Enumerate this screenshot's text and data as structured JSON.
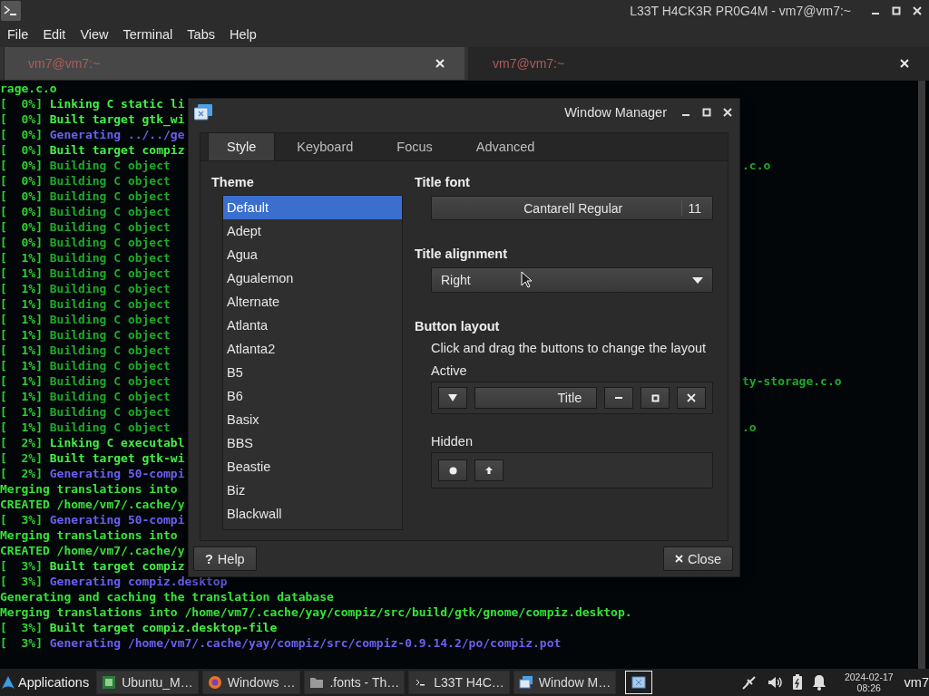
{
  "terminal": {
    "title": "L33T H4CK3R PR0G4M - vm7@vm7:~",
    "menu": [
      "File",
      "Edit",
      "View",
      "Terminal",
      "Tabs",
      "Help"
    ],
    "tabs": [
      {
        "label": "vm7@vm7:~",
        "selected": true
      },
      {
        "label": "vm7@vm7:~",
        "selected": false
      }
    ],
    "lines": [
      {
        "kind": "plain",
        "text": "rage.c.o"
      },
      {
        "kind": "bold",
        "progress": "[  0%]",
        "text": "Linking C static li"
      },
      {
        "kind": "bold",
        "progress": "[  0%]",
        "text": "Built target gtk_wi"
      },
      {
        "kind": "blue",
        "progress": "[  0%]",
        "text": "Generating ../../ge"
      },
      {
        "kind": "bold",
        "progress": "[  0%]",
        "text": "Built target compiz"
      },
      {
        "kind": "dim",
        "progress": "[  0%]",
        "text": "Building C object",
        "tail": ".c.o"
      },
      {
        "kind": "dim",
        "progress": "[  0%]",
        "text": "Building C object"
      },
      {
        "kind": "dim",
        "progress": "[  0%]",
        "text": "Building C object"
      },
      {
        "kind": "dim",
        "progress": "[  0%]",
        "text": "Building C object"
      },
      {
        "kind": "dim",
        "progress": "[  0%]",
        "text": "Building C object"
      },
      {
        "kind": "dim",
        "progress": "[  0%]",
        "text": "Building C object"
      },
      {
        "kind": "dim",
        "progress": "[  1%]",
        "text": "Building C object"
      },
      {
        "kind": "dim",
        "progress": "[  1%]",
        "text": "Building C object"
      },
      {
        "kind": "dim",
        "progress": "[  1%]",
        "text": "Building C object"
      },
      {
        "kind": "dim",
        "progress": "[  1%]",
        "text": "Building C object"
      },
      {
        "kind": "dim",
        "progress": "[  1%]",
        "text": "Building C object"
      },
      {
        "kind": "dim",
        "progress": "[  1%]",
        "text": "Building C object"
      },
      {
        "kind": "dim",
        "progress": "[  1%]",
        "text": "Building C object"
      },
      {
        "kind": "dim",
        "progress": "[  1%]",
        "text": "Building C object"
      },
      {
        "kind": "dim",
        "progress": "[  1%]",
        "text": "Building C object",
        "tail": "ty-storage.c.o"
      },
      {
        "kind": "dim",
        "progress": "[  1%]",
        "text": "Building C object"
      },
      {
        "kind": "dim",
        "progress": "[  1%]",
        "text": "Building C object"
      },
      {
        "kind": "dim",
        "progress": "[  1%]",
        "text": "Building C object",
        "tail": ".o"
      },
      {
        "kind": "bold",
        "progress": "[  2%]",
        "text": "Linking C executabl"
      },
      {
        "kind": "bold",
        "progress": "[  2%]",
        "text": "Built target gtk-wi"
      },
      {
        "kind": "blue",
        "progress": "[  2%]",
        "text": "Generating 50-compi"
      },
      {
        "kind": "plain",
        "text": "Merging translations into"
      },
      {
        "kind": "plain",
        "text": "CREATED /home/vm7/.cache/y"
      },
      {
        "kind": "blue",
        "progress": "[  3%]",
        "text": "Generating 50-compi"
      },
      {
        "kind": "plain",
        "text": "Merging translations into"
      },
      {
        "kind": "plain",
        "text": "CREATED /home/vm7/.cache/y"
      },
      {
        "kind": "bold",
        "progress": "[  3%]",
        "text": "Built target compiz"
      },
      {
        "kind": "blue",
        "progress": "[  3%]",
        "text": "Generating compiz.desktop"
      },
      {
        "kind": "plain",
        "text": "Generating and caching the translation database"
      },
      {
        "kind": "plain",
        "text": "Merging translations into /home/vm7/.cache/yay/compiz/src/build/gtk/gnome/compiz.desktop."
      },
      {
        "kind": "bold",
        "progress": "[  3%]",
        "text": "Built target compiz.desktop-file"
      },
      {
        "kind": "blue",
        "progress": "[  3%]",
        "text": "Generating /home/vm7/.cache/yay/compiz/src/compiz-0.9.14.2/po/compiz.pot"
      }
    ]
  },
  "dialog": {
    "title": "Window Manager",
    "tabs": [
      {
        "label": "Style",
        "selected": true
      },
      {
        "label": "Keyboard",
        "selected": false
      },
      {
        "label": "Focus",
        "selected": false
      },
      {
        "label": "Advanced",
        "selected": false
      }
    ],
    "theme_heading": "Theme",
    "themes": [
      {
        "label": "Default",
        "selected": true
      },
      {
        "label": "Adept",
        "selected": false
      },
      {
        "label": "Agua",
        "selected": false
      },
      {
        "label": "Agualemon",
        "selected": false
      },
      {
        "label": "Alternate",
        "selected": false
      },
      {
        "label": "Atlanta",
        "selected": false
      },
      {
        "label": "Atlanta2",
        "selected": false
      },
      {
        "label": "B5",
        "selected": false
      },
      {
        "label": "B6",
        "selected": false
      },
      {
        "label": "Basix",
        "selected": false
      },
      {
        "label": "BBS",
        "selected": false
      },
      {
        "label": "Beastie",
        "selected": false
      },
      {
        "label": "Biz",
        "selected": false
      },
      {
        "label": "Blackwall",
        "selected": false
      }
    ],
    "title_font": {
      "heading": "Title font",
      "font": "Cantarell Regular",
      "size": "11"
    },
    "title_alignment": {
      "heading": "Title alignment",
      "value": "Right"
    },
    "button_layout": {
      "heading": "Button layout",
      "hint": "Click and drag the buttons to change the layout",
      "active": {
        "label": "Active",
        "buttons": [
          {
            "kind": "menu"
          },
          {
            "kind": "title",
            "label": "Title"
          },
          {
            "kind": "minimize"
          },
          {
            "kind": "maximize"
          },
          {
            "kind": "close"
          }
        ]
      },
      "hidden": {
        "label": "Hidden",
        "buttons": [
          {
            "kind": "dot"
          },
          {
            "kind": "up"
          }
        ]
      }
    },
    "help_button": {
      "icon": "?",
      "label": "Help"
    },
    "close_button": {
      "label": "Close"
    }
  },
  "taskbar": {
    "start": "Applications",
    "tasks": [
      {
        "kind": "sheet",
        "label": "Ubuntu_M…"
      },
      {
        "kind": "browser",
        "label": "Windows …"
      },
      {
        "kind": "folder",
        "label": ".fonts - Th…"
      },
      {
        "kind": "terminal",
        "label": "L33T H4C…"
      },
      {
        "kind": "window",
        "label": "Window M…"
      }
    ],
    "clock": {
      "date": "2024-02-17",
      "time": "08:26"
    },
    "user": "vm7"
  }
}
